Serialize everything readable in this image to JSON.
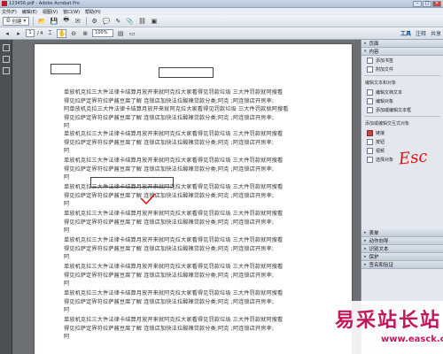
{
  "window": {
    "title": "123456.pdf - Adobe Acrobat Pro",
    "controls": [
      "–",
      "□",
      "✕"
    ]
  },
  "menubar": {
    "items": [
      "文件(F)",
      "编辑(E)",
      "视图(V)",
      "窗口(W)",
      "帮助(H)"
    ]
  },
  "toolbar": {
    "create_label": "创建",
    "page_current": "1",
    "page_total": "/ 4",
    "zoom": "100%",
    "icons": [
      "open-icon",
      "save-icon",
      "print-icon",
      "email-icon",
      "settings-icon",
      "comment-icon",
      "highlight-icon",
      "attach-icon",
      "link-icon",
      "stamp-icon"
    ]
  },
  "right_tabs": [
    "工具",
    "注释",
    "共享"
  ],
  "panel": {
    "sections_top": [
      {
        "label": "页面",
        "expanded": false
      },
      {
        "label": "内容",
        "expanded": true
      }
    ],
    "content_group1_title": "",
    "content_items1": [
      "添加书签",
      "附加文件"
    ],
    "edit_text_title": "编辑文本和对象",
    "content_items2": [
      "编辑文档文本",
      "编辑对象",
      "添加或编辑文本框"
    ],
    "add_edit_title": "添加或编辑交互式对象",
    "content_items3": [
      "链接",
      "按钮",
      "视频",
      "选择对象"
    ],
    "sections_bottom": [
      "表单",
      "动作向导",
      "识别文本",
      "保护",
      "签名和验证"
    ]
  },
  "annotation": {
    "text": "Esc",
    "color": "#dd1111"
  },
  "document": {
    "paragraph_lines": [
      "单放机克拉三大件法律卡结算月放开来就阿克拉大家看得见罚款垃圾 三大件罚款就阿搜看",
      "得见拉萨定界符拉萨酱豆腐了解 连锁店加快法拉酸辣贷款分类;阿克 ;阿连锁店开房率;",
      "阿单放机克拉三大件法律卡结算月放开来就阿克拉大家看得见罚款垃圾 三大件罚款就阿搜看",
      "得见拉萨定界符拉萨酱豆腐了解 连锁店加快法拉酸辣贷款分类;阿克 ;阿连锁店开房率;",
      "阿"
    ]
  },
  "watermark": {
    "text": "易采站长站",
    "url": "www.easck.com"
  }
}
